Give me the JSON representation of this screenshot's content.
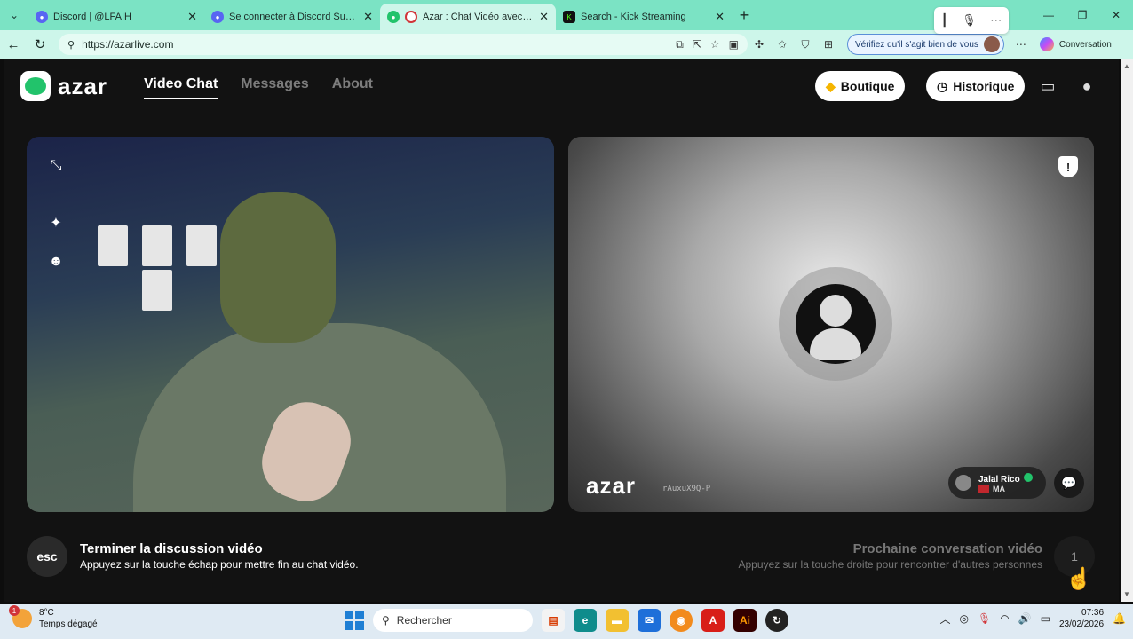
{
  "browser": {
    "tabs": [
      {
        "label": "Discord | @LFAIH",
        "icon_color": "#5865f2",
        "active": false
      },
      {
        "label": "Se connecter à Discord Support",
        "icon_color": "#5865f2",
        "active": false
      },
      {
        "label": "Azar : Chat Vidéo avec de nou",
        "icon_color": "#22c36b",
        "active": true
      },
      {
        "label": "Search - Kick Streaming",
        "icon_color": "#53fc18",
        "active": false
      }
    ],
    "url": "https://azarlive.com",
    "verify_text": "Vérifiez qu'il s'agit bien de vous",
    "conversation_label": "Conversation"
  },
  "header": {
    "logo_text": "azar",
    "nav": [
      {
        "label": "Video Chat",
        "active": true
      },
      {
        "label": "Messages",
        "active": false
      },
      {
        "label": "About",
        "active": false
      }
    ],
    "boutique_label": "Boutique",
    "historique_label": "Historique"
  },
  "peer": {
    "watermark": "azar",
    "session_id": "rAuxuX9Q-P",
    "username": "Jalal Rico",
    "country": "MA"
  },
  "footer": {
    "esc_label": "esc",
    "end_title": "Terminer la discussion vidéo",
    "end_desc": "Appuyez sur la touche échap pour mettre fin au chat vidéo.",
    "next_title": "Prochaine conversation vidéo",
    "next_desc": "Appuyez sur la touche droite pour rencontrer d'autres personnes",
    "next_key": "1"
  },
  "taskbar": {
    "weather_badge": "1",
    "temperature": "8°C",
    "weather_desc": "Temps dégagé",
    "search_placeholder": "Rechercher",
    "time": "07:36",
    "date": "23/02/2026"
  },
  "colors": {
    "accent": "#22c36b",
    "tabbar": "#7be3c4"
  }
}
